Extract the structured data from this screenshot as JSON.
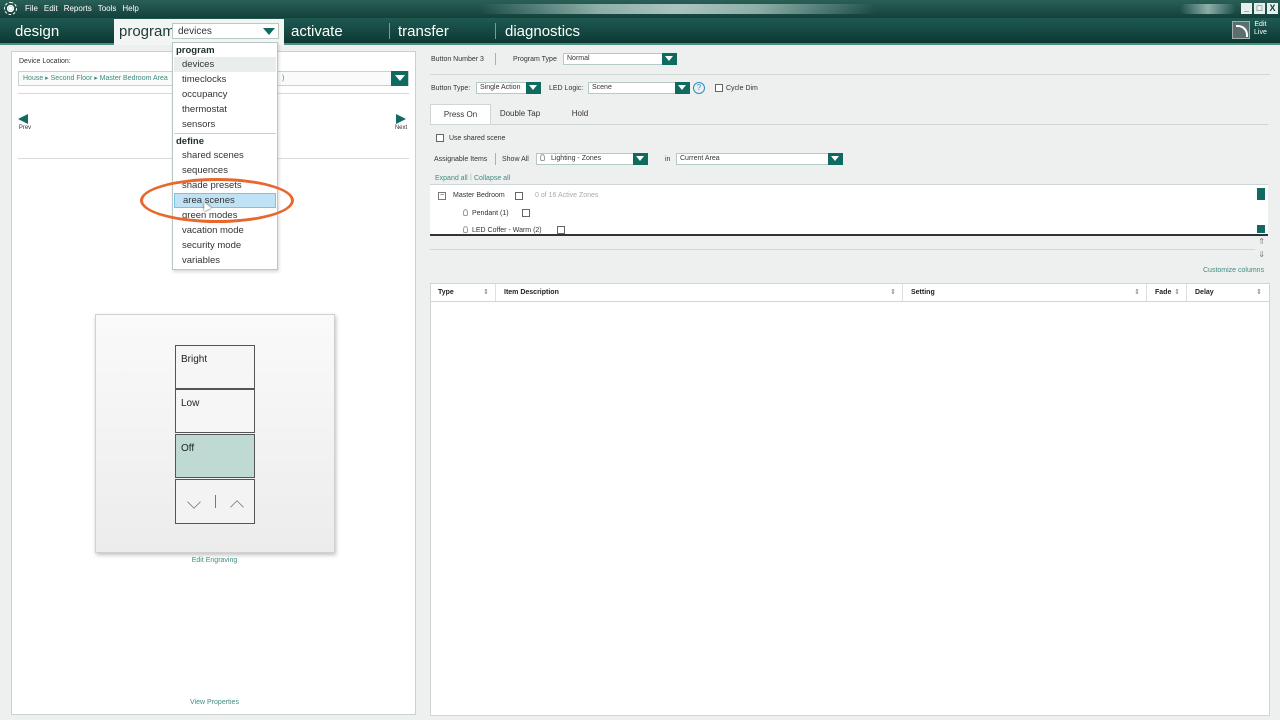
{
  "menu": [
    "File",
    "Edit",
    "Reports",
    "Tools",
    "Help"
  ],
  "window_controls": [
    "_",
    "□",
    "X"
  ],
  "nav": {
    "design": "design",
    "program": "program",
    "program_select": "devices",
    "activate": "activate",
    "transfer": "transfer",
    "diagnostics": "diagnostics",
    "edit_live": "Edit\nLive"
  },
  "dropdown": {
    "header_program": "program",
    "header_define": "define",
    "items_program": [
      "devices",
      "timeclocks",
      "occupancy",
      "thermostat",
      "sensors"
    ],
    "items_define": [
      "shared scenes",
      "sequences",
      "shade presets",
      "area scenes",
      "green modes",
      "vacation mode",
      "security mode",
      "variables"
    ],
    "selected": "devices",
    "highlighted": "area scenes"
  },
  "left": {
    "device_location_label": "Device Location:",
    "device_location_value": "House ▸ Second Floor ▸ Master Bedroom Area",
    "device_location_tail": ")",
    "prev": "Prev",
    "next": "Next",
    "keypad_buttons": [
      {
        "label": "Bright",
        "active": false
      },
      {
        "label": "Low",
        "active": false
      },
      {
        "label": "Off",
        "active": true
      }
    ],
    "edit_engraving": "Edit Engraving",
    "view_properties": "View Properties"
  },
  "right": {
    "button_number": "Button Number 3",
    "program_type_label": "Program Type",
    "program_type_value": "Normal",
    "button_type_label": "Button Type:",
    "button_type_value": "Single Action",
    "led_logic_label": "LED Logic:",
    "led_logic_value": "Scene",
    "help": "?",
    "cycle_dim": "Cycle Dim",
    "tabs": [
      "Press On",
      "Double Tap",
      "Hold"
    ],
    "active_tab": "Press On",
    "use_shared_scene": "Use shared scene",
    "assignable_items": "Assignable Items",
    "show_all": "Show All",
    "filter_value": "Lighting - Zones",
    "in_label": "in",
    "area_value": "Current Area",
    "expand_all": "Expand all",
    "collapse_all": "Collapse all",
    "tree": {
      "root": "Master Bedroom",
      "root_expander": "−",
      "root_status": "0 of 16 Active Zones",
      "children": [
        "Pendant (1)",
        "LED  Coffer - Warm (2)"
      ]
    },
    "customize_columns": "Customize columns",
    "grid_columns": [
      "Type",
      "Item Description",
      "Setting",
      "Fade",
      "Delay"
    ]
  },
  "colors": {
    "brand_dark": "#0d3832",
    "accent": "#0f6a60",
    "link": "#3f8c80",
    "highlight_ring": "#e8672c",
    "menu_highlight": "#bfe3f5"
  }
}
